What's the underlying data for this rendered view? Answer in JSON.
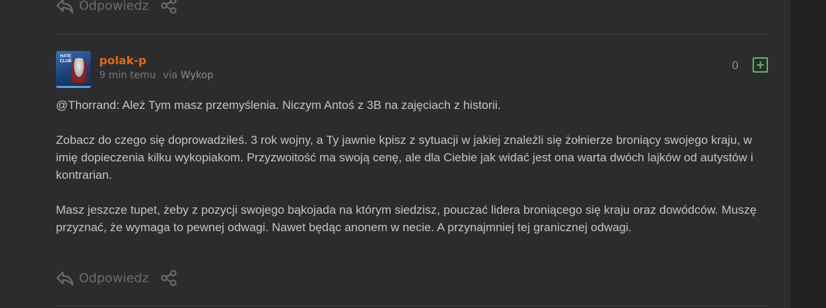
{
  "previous_comment": {
    "reply_label": "Odpowiedz"
  },
  "comment": {
    "author": "polak-p",
    "avatar_text": "HATE CLUB",
    "time_ago": "9 min temu",
    "via_prefix": "via",
    "via_app": "Wykop",
    "vote_count": "0",
    "mention": "@Thorrand",
    "mention_suffix": ": Ależ Tym masz przemyślenia. Niczym Antoś z 3B na zajęciach z historii.",
    "paragraph_2": "Zobacz do czego się doprowadziłeś. 3 rok wojny, a Ty jawnie kpisz z sytuacji w jakiej znaleźli się żołnierze broniący swojego kraju, w imię dopieczenia kilku wykopiakom. Przyzwoitość ma swoją cenę, ale dla Ciebie jak widać jest ona warta dwóch lajków od autystów i kontrarian.",
    "paragraph_3": "Masz jeszcze tupet, żeby z pozycji swojego bąkojada na którym siedzisz, pouczać lidera broniącego się kraju oraz dowódców. Muszę przyznać, że wymaga to pewnej odwagi. Nawet będąc anonem w necie. A przynajmniej tej granicznej odwagi.",
    "reply_label": "Odpowiedz"
  },
  "colors": {
    "background": "#2c2c2e",
    "username": "#e2691a",
    "vote_plus": "#5fb85a",
    "muted": "#6b6b6b"
  },
  "icons": {
    "reply": "reply-arrow-icon",
    "share": "share-icon",
    "vote": "plus-square-icon"
  }
}
